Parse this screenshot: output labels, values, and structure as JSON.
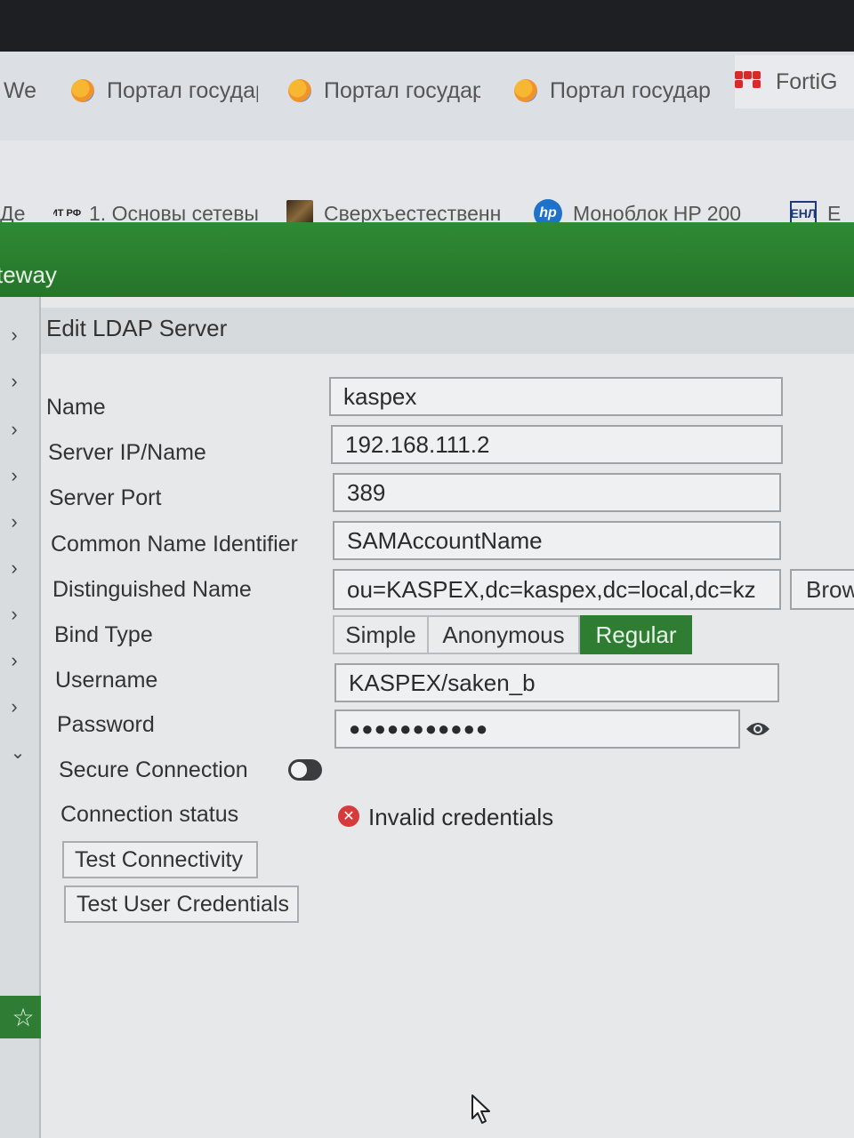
{
  "browser": {
    "tabs": [
      {
        "label": "We"
      },
      {
        "label": "Портал государ"
      },
      {
        "label": "Портал государ"
      },
      {
        "label": "Портал государ"
      },
      {
        "label": "FortiG"
      }
    ],
    "bookmarks": [
      {
        "label": "Де"
      },
      {
        "icon_text": "ИТ РФ",
        "label": "1. Основы сетевы"
      },
      {
        "label": "Сверхъестественн"
      },
      {
        "icon_text": "hp",
        "label": "Моноблок HP 200"
      },
      {
        "icon_text": "ЕНЛ",
        "label": "Е"
      }
    ]
  },
  "app": {
    "title": "teway",
    "accent_color": "#2e7d32"
  },
  "dialog": {
    "title": "Edit LDAP Server",
    "fields": {
      "name": {
        "label": "Name",
        "value": "kaspex"
      },
      "server": {
        "label": "Server IP/Name",
        "value": "192.168.111.2"
      },
      "port": {
        "label": "Server Port",
        "value": "389"
      },
      "cn": {
        "label": "Common Name Identifier",
        "value": "SAMAccountName"
      },
      "dn": {
        "label": "Distinguished Name",
        "value": "ou=KASPEX,dc=kaspex,dc=local,dc=kz",
        "browse_label": "Brow"
      },
      "bind_type": {
        "label": "Bind Type",
        "options": [
          "Simple",
          "Anonymous",
          "Regular"
        ],
        "selected": "Regular"
      },
      "username": {
        "label": "Username",
        "value": "KASPEX/saken_b"
      },
      "password": {
        "label": "Password",
        "value": "●●●●●●●●●●●"
      },
      "secure": {
        "label": "Secure Connection"
      },
      "status": {
        "label": "Connection status",
        "value": "Invalid credentials",
        "icon": "error-icon",
        "color": "#d63a3a"
      }
    },
    "buttons": {
      "test_connectivity": "Test Connectivity",
      "test_user_credentials": "Test User Credentials"
    }
  }
}
